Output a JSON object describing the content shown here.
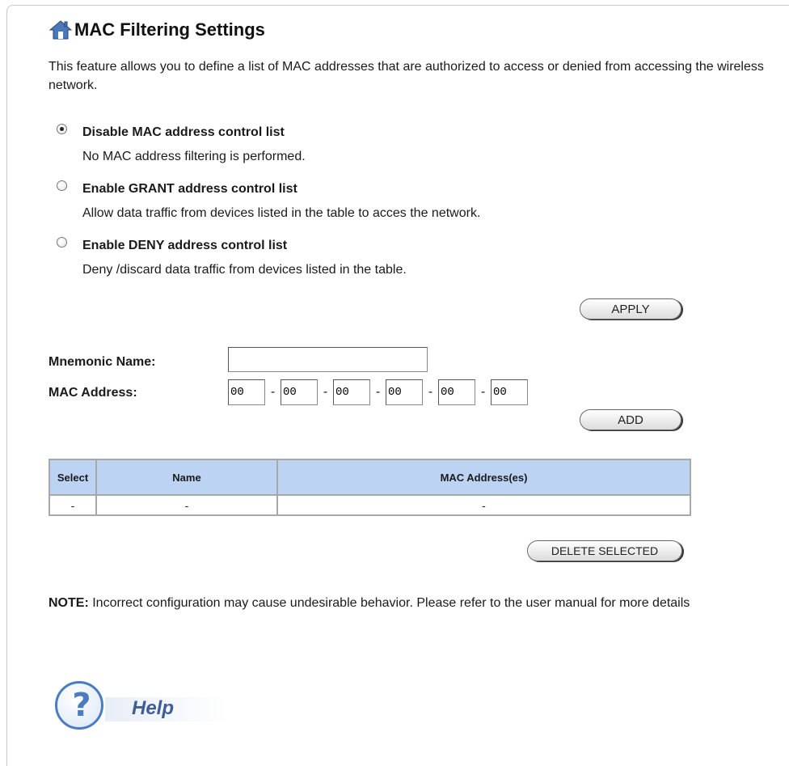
{
  "page": {
    "title": "MAC Filtering Settings",
    "intro": "This feature allows you to define a list of MAC addresses that are authorized to access or denied from accessing the wireless network."
  },
  "radios": [
    {
      "label": "Disable MAC address control list",
      "desc": "No MAC address filtering is performed.",
      "checked": true
    },
    {
      "label": "Enable GRANT address control list",
      "desc": "Allow data traffic from devices listed in the table to acces the network.",
      "checked": false
    },
    {
      "label": "Enable DENY address control list",
      "desc": "Deny /discard data traffic from devices listed in the table.",
      "checked": false
    }
  ],
  "buttons": {
    "apply": "APPLY",
    "add": "ADD",
    "delete_selected": "DELETE SELECTED"
  },
  "form": {
    "name_label": "Mnemonic Name:",
    "name_value": "",
    "mac_label": "MAC Address:",
    "mac_octets": [
      "00",
      "00",
      "00",
      "00",
      "00",
      "00"
    ],
    "mac_separator": "-"
  },
  "table": {
    "headers": [
      "Select",
      "Name",
      "MAC Address(es)"
    ],
    "rows": [
      [
        "-",
        "-",
        "-"
      ]
    ]
  },
  "note": {
    "prefix": "NOTE:",
    "text": " Incorrect configuration may cause undesirable behavior. Please refer to the user manual for more details"
  },
  "help": {
    "label": "Help"
  },
  "icons": {
    "title_icon": "home-icon",
    "help_icon": "help-question-icon"
  },
  "colors": {
    "table_header_bg": "#bcd3f4",
    "help_blue": "#4a7cbf"
  }
}
